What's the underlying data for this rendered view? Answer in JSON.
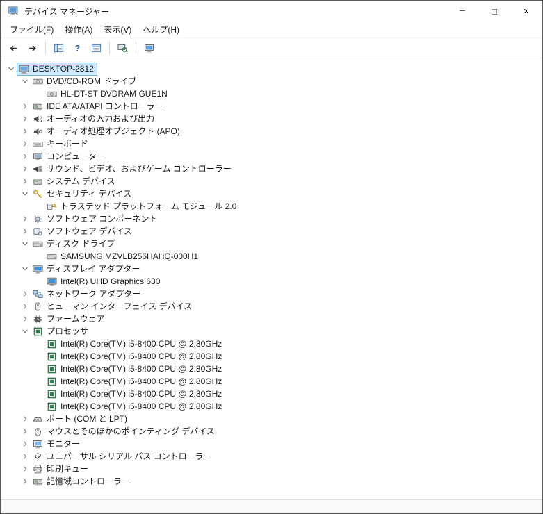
{
  "window": {
    "title": "デバイス マネージャー",
    "controls": {
      "minimize_glyph": "─",
      "maximize_glyph": "□",
      "close_glyph": "✕"
    }
  },
  "menu": {
    "items": [
      {
        "id": "file",
        "label": "ファイル(F)"
      },
      {
        "id": "action",
        "label": "操作(A)"
      },
      {
        "id": "view",
        "label": "表示(V)"
      },
      {
        "id": "help",
        "label": "ヘルプ(H)"
      }
    ]
  },
  "toolbar": {
    "buttons": [
      {
        "type": "button",
        "name": "navigate-back",
        "icon": "back-arrow-icon"
      },
      {
        "type": "button",
        "name": "navigate-forward",
        "icon": "forward-arrow-icon"
      },
      {
        "type": "separator"
      },
      {
        "type": "button",
        "name": "show-console-tree",
        "icon": "show-console-tree-icon"
      },
      {
        "type": "button",
        "name": "help",
        "icon": "help-icon"
      },
      {
        "type": "button",
        "name": "properties",
        "icon": "properties-icon"
      },
      {
        "type": "separator"
      },
      {
        "type": "button",
        "name": "scan-hardware-changes",
        "icon": "scan-hardware-icon"
      },
      {
        "type": "separator"
      },
      {
        "type": "button",
        "name": "legacy-hardware",
        "icon": "legacy-hardware-icon"
      }
    ]
  },
  "tree": {
    "items": [
      {
        "level": 0,
        "state": "expanded",
        "icon": "computer-icon",
        "label": "DESKTOP-2812",
        "selected": true
      },
      {
        "level": 1,
        "state": "expanded",
        "icon": "dvd-drive-icon",
        "label": "DVD/CD-ROM ドライブ"
      },
      {
        "level": 2,
        "state": "leaf",
        "icon": "dvd-drive-icon",
        "label": "HL-DT-ST DVDRAM GUE1N"
      },
      {
        "level": 1,
        "state": "collapsed",
        "icon": "storage-controller-icon",
        "label": "IDE ATA/ATAPI コントローラー"
      },
      {
        "level": 1,
        "state": "collapsed",
        "icon": "audio-io-icon",
        "label": "オーディオの入力および出力"
      },
      {
        "level": 1,
        "state": "collapsed",
        "icon": "audio-apo-icon",
        "label": "オーディオ処理オブジェクト (APO)"
      },
      {
        "level": 1,
        "state": "collapsed",
        "icon": "keyboard-icon",
        "label": "キーボード"
      },
      {
        "level": 1,
        "state": "collapsed",
        "icon": "system-computer-icon",
        "label": "コンピューター"
      },
      {
        "level": 1,
        "state": "collapsed",
        "icon": "sound-icon",
        "label": "サウンド、ビデオ、およびゲーム コントローラー"
      },
      {
        "level": 1,
        "state": "collapsed",
        "icon": "system-device-icon",
        "label": "システム デバイス"
      },
      {
        "level": 1,
        "state": "expanded",
        "icon": "security-icon",
        "label": "セキュリティ デバイス"
      },
      {
        "level": 2,
        "state": "leaf",
        "icon": "tpm-icon",
        "label": "トラステッド プラットフォーム モジュール 2.0"
      },
      {
        "level": 1,
        "state": "collapsed",
        "icon": "software-component-icon",
        "label": "ソフトウェア コンポーネント"
      },
      {
        "level": 1,
        "state": "collapsed",
        "icon": "software-device-icon",
        "label": "ソフトウェア デバイス"
      },
      {
        "level": 1,
        "state": "expanded",
        "icon": "disk-drive-icon",
        "label": "ディスク ドライブ"
      },
      {
        "level": 2,
        "state": "leaf",
        "icon": "disk-drive-icon",
        "label": "SAMSUNG MZVLB256HAHQ-000H1"
      },
      {
        "level": 1,
        "state": "expanded",
        "icon": "display-adapter-icon",
        "label": "ディスプレイ アダプター"
      },
      {
        "level": 2,
        "state": "leaf",
        "icon": "display-adapter-icon",
        "label": "Intel(R) UHD Graphics 630"
      },
      {
        "level": 1,
        "state": "collapsed",
        "icon": "network-adapter-icon",
        "label": "ネットワーク アダプター"
      },
      {
        "level": 1,
        "state": "collapsed",
        "icon": "hid-icon",
        "label": "ヒューマン インターフェイス デバイス"
      },
      {
        "level": 1,
        "state": "collapsed",
        "icon": "firmware-icon",
        "label": "ファームウェア"
      },
      {
        "level": 1,
        "state": "expanded",
        "icon": "processor-icon",
        "label": "プロセッサ"
      },
      {
        "level": 2,
        "state": "leaf",
        "icon": "processor-icon",
        "label": "Intel(R) Core(TM) i5-8400 CPU @ 2.80GHz"
      },
      {
        "level": 2,
        "state": "leaf",
        "icon": "processor-icon",
        "label": "Intel(R) Core(TM) i5-8400 CPU @ 2.80GHz"
      },
      {
        "level": 2,
        "state": "leaf",
        "icon": "processor-icon",
        "label": "Intel(R) Core(TM) i5-8400 CPU @ 2.80GHz"
      },
      {
        "level": 2,
        "state": "leaf",
        "icon": "processor-icon",
        "label": "Intel(R) Core(TM) i5-8400 CPU @ 2.80GHz"
      },
      {
        "level": 2,
        "state": "leaf",
        "icon": "processor-icon",
        "label": "Intel(R) Core(TM) i5-8400 CPU @ 2.80GHz"
      },
      {
        "level": 2,
        "state": "leaf",
        "icon": "processor-icon",
        "label": "Intel(R) Core(TM) i5-8400 CPU @ 2.80GHz"
      },
      {
        "level": 1,
        "state": "collapsed",
        "icon": "port-icon",
        "label": "ポート (COM と LPT)"
      },
      {
        "level": 1,
        "state": "collapsed",
        "icon": "mouse-icon",
        "label": "マウスとそのほかのポインティング デバイス"
      },
      {
        "level": 1,
        "state": "collapsed",
        "icon": "monitor-icon",
        "label": "モニター"
      },
      {
        "level": 1,
        "state": "collapsed",
        "icon": "usb-icon",
        "label": "ユニバーサル シリアル バス コントローラー"
      },
      {
        "level": 1,
        "state": "collapsed",
        "icon": "print-queue-icon",
        "label": "印刷キュー"
      },
      {
        "level": 1,
        "state": "collapsed",
        "icon": "storage-controller-icon",
        "label": "記憶域コントローラー"
      }
    ]
  },
  "statusbar": {
    "text": ""
  },
  "colors": {
    "selection_fill": "#cce8ff",
    "selection_border": "#70b8e8",
    "processor_green": "#2e7d4f",
    "key_gold": "#c8a232",
    "screen_blue": "#5b9bd5"
  }
}
